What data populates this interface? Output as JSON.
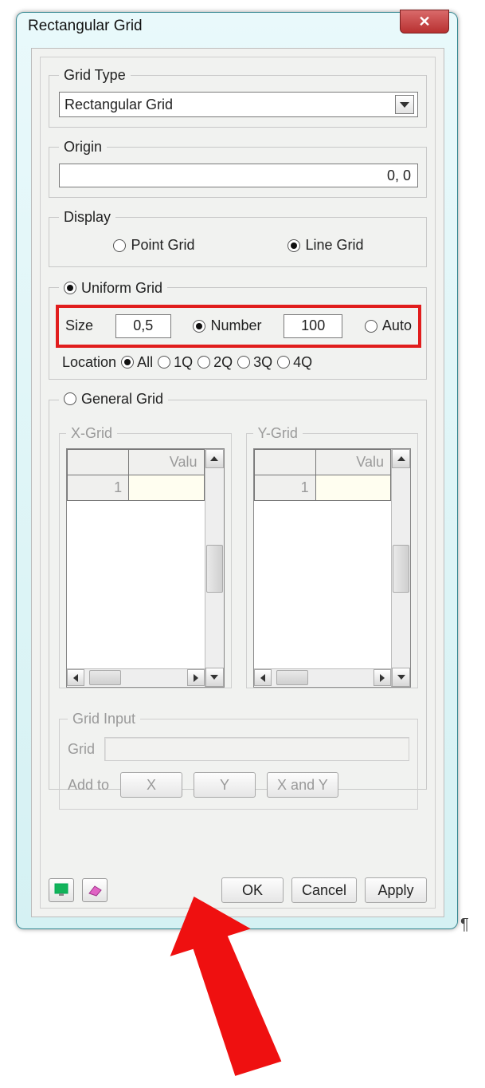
{
  "title": "Rectangular Grid",
  "close_glyph": "✕",
  "grid_type": {
    "legend": "Grid Type",
    "value": "Rectangular Grid"
  },
  "origin": {
    "legend": "Origin",
    "value": "0, 0"
  },
  "display": {
    "legend": "Display",
    "point_label": "Point Grid",
    "line_label": "Line Grid",
    "selected": "line"
  },
  "uniform": {
    "legend": "Uniform Grid",
    "size_label": "Size",
    "size_value": "0,5",
    "number_label": "Number",
    "number_value": "100",
    "auto_label": "Auto",
    "selected_radio": "number",
    "location_label": "Location",
    "location_options": [
      "All",
      "1Q",
      "2Q",
      "3Q",
      "4Q"
    ],
    "location_selected": "All"
  },
  "general": {
    "legend": "General Grid",
    "xgrid_legend": "X-Grid",
    "ygrid_legend": "Y-Grid",
    "value_header": "Valu",
    "row_index": "1"
  },
  "grid_input": {
    "legend": "Grid Input",
    "grid_label": "Grid",
    "addto_label": "Add to",
    "btn_x": "X",
    "btn_y": "Y",
    "btn_xy": "X and Y"
  },
  "buttons": {
    "ok": "OK",
    "cancel": "Cancel",
    "apply": "Apply"
  }
}
